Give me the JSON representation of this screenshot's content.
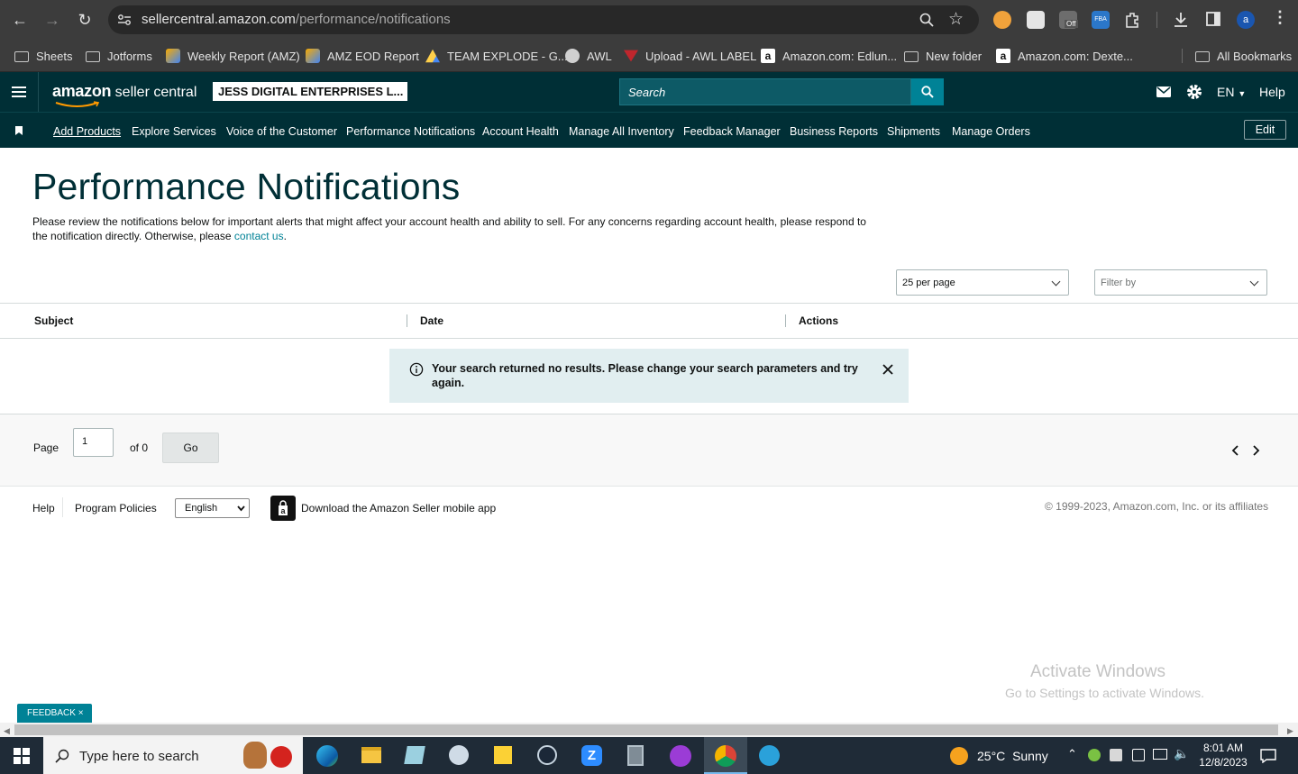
{
  "browser": {
    "url_host": "sellercentral.amazon.com",
    "url_path": "/performance/notifications",
    "profile_initial": "a",
    "extension_badge": "Off",
    "ext_fba_label": "FBA",
    "bookmarks": [
      {
        "label": "Sheets",
        "icon": "folder-icon"
      },
      {
        "label": "Jotforms",
        "icon": "folder-icon"
      },
      {
        "label": "Weekly Report (AMZ)",
        "icon": "looker-icon"
      },
      {
        "label": "AMZ EOD Report",
        "icon": "looker-icon"
      },
      {
        "label": "TEAM EXPLODE - G...",
        "icon": "drive-icon"
      },
      {
        "label": "AWL",
        "icon": "globe-icon"
      },
      {
        "label": "Upload - AWL LABEL",
        "icon": "awl-icon"
      },
      {
        "label": "Amazon.com: Edlun...",
        "icon": "amazon-icon"
      },
      {
        "label": "New folder",
        "icon": "folder-icon"
      },
      {
        "label": "Amazon.com: Dexte...",
        "icon": "amazon-icon"
      }
    ],
    "all_bookmarks": "All Bookmarks"
  },
  "header": {
    "logo_text_1": "amazon",
    "logo_text_2": "seller central",
    "account_name": "JESS DIGITAL ENTERPRISES L...",
    "search_placeholder": "Search",
    "language": "EN",
    "help": "Help"
  },
  "nav": {
    "links": [
      "Add Products",
      "Explore Services",
      "Voice of the Customer",
      "Performance Notifications",
      "Account Health",
      "Manage All Inventory",
      "Feedback Manager",
      "Business Reports",
      "Shipments",
      "Manage Orders"
    ],
    "edit": "Edit"
  },
  "main": {
    "title": "Performance Notifications",
    "intro_line1": "Please review the notifications below for important alerts that might affect your account health and ability to sell. For any concerns regarding account health, please respond to",
    "intro_line2": "the notification directly. Otherwise, please ",
    "contact_link": "contact us",
    "intro_end": ".",
    "per_page": "25 per page",
    "filter_placeholder": "Filter by",
    "columns": [
      "Subject",
      "Date",
      "Actions"
    ],
    "alert_text": "Your search returned no results. Please change your search parameters and try again."
  },
  "pager": {
    "page_label": "Page",
    "page_value": "1",
    "of_label": "of 0",
    "go": "Go"
  },
  "footer": {
    "help": "Help",
    "policies": "Program Policies",
    "language_select": "English",
    "app_text": "Download the Amazon Seller mobile app",
    "copyright": "© 1999-2023, Amazon.com, Inc. or its affiliates"
  },
  "feedback": "FEEDBACK",
  "watermark": {
    "line1": "Activate Windows",
    "line2": "Go to Settings to activate Windows."
  },
  "taskbar": {
    "search_placeholder": "Type here to search",
    "weather_temp": "25°C",
    "weather_desc": "Sunny",
    "time": "8:01 AM",
    "date": "12/8/2023"
  }
}
